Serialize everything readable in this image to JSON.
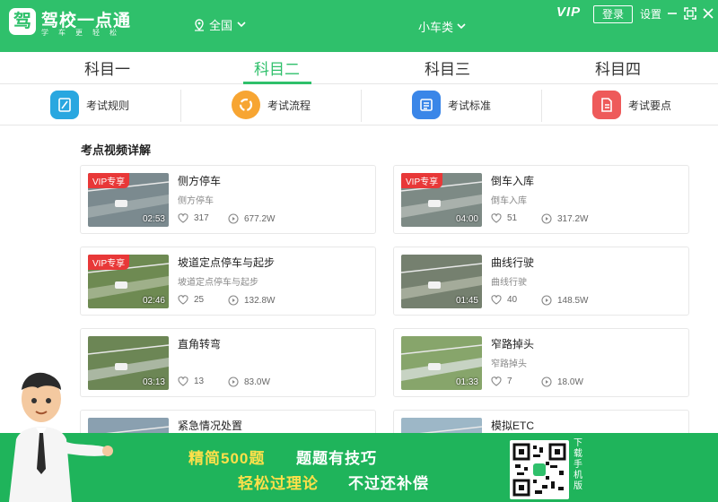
{
  "header": {
    "logo_char": "驾",
    "app_name": "驾校一点通",
    "slogan": "学车更轻松",
    "location": "全国",
    "car_type": "小车类",
    "vip": "VIP",
    "login": "登录",
    "settings": "设置"
  },
  "tabs": [
    "科目一",
    "科目二",
    "科目三",
    "科目四"
  ],
  "active_tab": 1,
  "features": [
    {
      "label": "考试规则",
      "icon": "rule-icon",
      "color": "#29a7e0"
    },
    {
      "label": "考试流程",
      "icon": "flow-icon",
      "color": "#f7a532"
    },
    {
      "label": "考试标准",
      "icon": "standard-icon",
      "color": "#3a86e8"
    },
    {
      "label": "考试要点",
      "icon": "keypoint-icon",
      "color": "#ee5a5a"
    }
  ],
  "section_title": "考点视频详解",
  "vip_badge": "VIP专享",
  "videos": [
    {
      "title": "侧方停车",
      "subtitle": "侧方停车",
      "likes": "317",
      "plays": "677.2W",
      "duration": "02:53",
      "vip": true
    },
    {
      "title": "倒车入库",
      "subtitle": "倒车入库",
      "likes": "51",
      "plays": "317.2W",
      "duration": "04:00",
      "vip": true
    },
    {
      "title": "坡道定点停车与起步",
      "subtitle": "坡道定点停车与起步",
      "likes": "25",
      "plays": "132.8W",
      "duration": "02:46",
      "vip": true
    },
    {
      "title": "曲线行驶",
      "subtitle": "曲线行驶",
      "likes": "40",
      "plays": "148.5W",
      "duration": "01:45",
      "vip": false
    },
    {
      "title": "直角转弯",
      "subtitle": "",
      "likes": "13",
      "plays": "83.0W",
      "duration": "03:13",
      "vip": false
    },
    {
      "title": "窄路掉头",
      "subtitle": "窄路掉头",
      "likes": "7",
      "plays": "18.0W",
      "duration": "01:33",
      "vip": false
    },
    {
      "title": "紧急情况处置",
      "subtitle": "",
      "likes": "",
      "plays": "",
      "duration": "",
      "vip": false
    },
    {
      "title": "模拟ETC",
      "subtitle": "",
      "likes": "",
      "plays": "",
      "duration": "",
      "vip": false
    }
  ],
  "banner": {
    "line1a": "精简500题",
    "line1b": "题题有技巧",
    "line2a": "轻松过理论",
    "line2b": "不过还补偿",
    "qr_label": "下载手机版"
  }
}
